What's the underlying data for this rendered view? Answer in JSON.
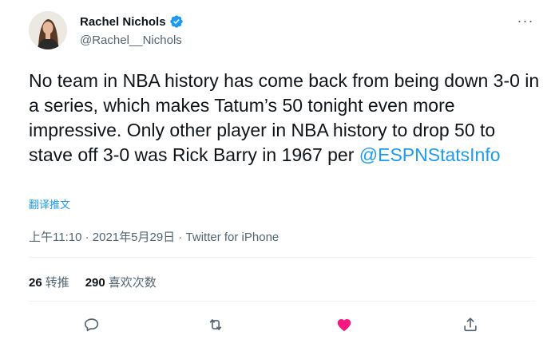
{
  "author": {
    "display_name": "Rachel Nichols",
    "handle": "@Rachel__Nichols"
  },
  "tweet": {
    "text": "No team in NBA history has come back from being down 3-0 in a series, which makes Tatum’s 50 tonight even more impressive. Only other player in NBA history to drop 50 to stave off 3-0 was Rick Barry in 1967 per ",
    "mention": "@ESPNStatsInfo",
    "translate_label": "翻译推文"
  },
  "meta": {
    "time": "上午11:10",
    "date": "2021年5月29日",
    "source": "Twitter for iPhone",
    "separator": " · "
  },
  "stats": {
    "retweets": {
      "count": "26",
      "label": "转推"
    },
    "likes": {
      "count": "290",
      "label": "喜欢次数"
    }
  },
  "more_label": "···",
  "icons": {
    "verified": "verified-badge-icon",
    "reply": "reply-icon",
    "retweet": "retweet-icon",
    "like": "heart-icon",
    "share": "share-icon"
  },
  "colors": {
    "accent": "#1d9bf0",
    "like": "#f91880",
    "muted": "#536471",
    "text": "#0f1419"
  }
}
